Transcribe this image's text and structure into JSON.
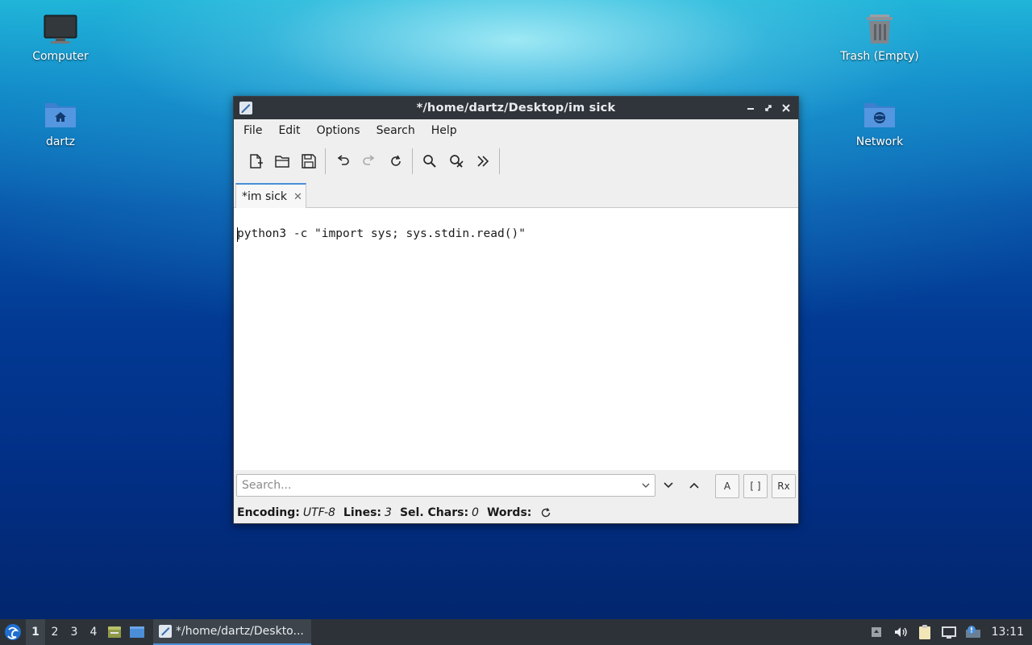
{
  "desktop": {
    "icons": [
      {
        "label": "Computer",
        "icon": "computer-icon"
      },
      {
        "label": "dartz",
        "icon": "home-folder-icon"
      },
      {
        "label": "Trash (Empty)",
        "icon": "trash-icon"
      },
      {
        "label": "Network",
        "icon": "network-folder-icon"
      }
    ]
  },
  "window": {
    "title": "*/home/dartz/Desktop/im sick",
    "menu": [
      "File",
      "Edit",
      "Options",
      "Search",
      "Help"
    ],
    "toolbar": [
      "new-file-icon",
      "open-file-icon",
      "save-icon",
      "undo-icon",
      "redo-icon",
      "reload-icon",
      "find-icon",
      "find-replace-icon",
      "more-icon"
    ],
    "tab": {
      "label": "*im sick",
      "close": "✕"
    },
    "editor": {
      "text": "python3 -c \"import sys; sys.stdin.read()\""
    },
    "search": {
      "placeholder": "Search...",
      "options": [
        "A",
        "[ ]",
        "Rx"
      ]
    },
    "status": {
      "encoding_label": "Encoding:",
      "encoding_value": "UTF-8",
      "lines_label": "Lines:",
      "lines_value": "3",
      "selchars_label": "Sel. Chars:",
      "selchars_value": "0",
      "words_label": "Words:"
    }
  },
  "taskbar": {
    "workspaces": [
      "1",
      "2",
      "3",
      "4"
    ],
    "active_workspace": "1",
    "task_label": "*/home/dartz/Deskto...",
    "clock": "13:11"
  },
  "colors": {
    "titlebar": "#2f353b",
    "taskbar": "#2d3238",
    "accent": "#4a8ed8"
  }
}
